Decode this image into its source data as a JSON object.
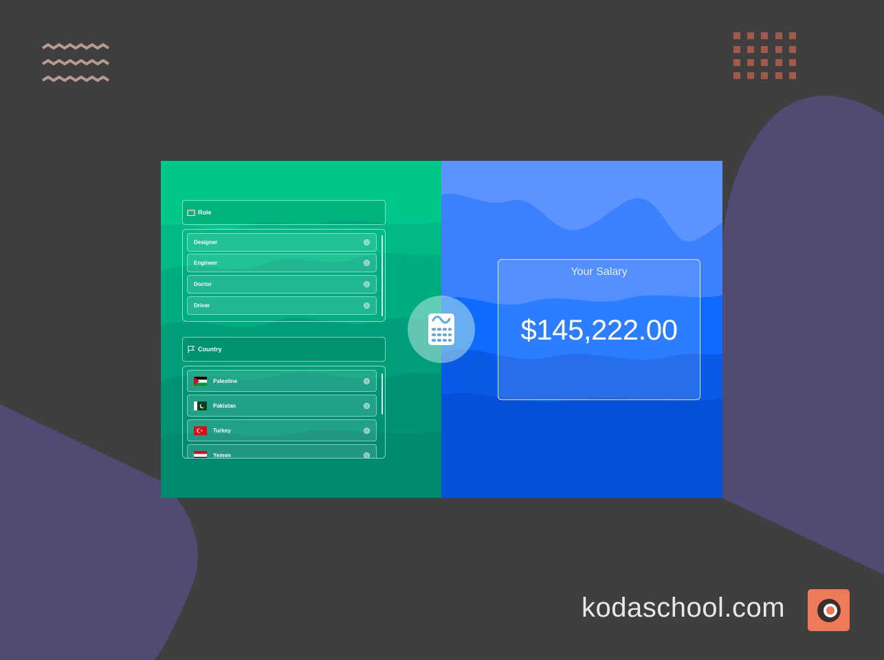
{
  "role": {
    "header": "Role",
    "options": [
      {
        "label": "Designer"
      },
      {
        "label": "Engineer"
      },
      {
        "label": "Doctor"
      },
      {
        "label": "Driver"
      }
    ]
  },
  "country": {
    "header": "Country",
    "options": [
      {
        "label": "Palestine",
        "flag": "palestine-flag-icon"
      },
      {
        "label": "Pakistan",
        "flag": "pakistan-flag-icon"
      },
      {
        "label": "Turkey",
        "flag": "turkey-flag-icon"
      },
      {
        "label": "Yemen",
        "flag": "yemen-flag-icon"
      }
    ]
  },
  "calculator": {
    "icon": "calculator-icon"
  },
  "salary": {
    "label": "Your Salary",
    "value": "$145,222.00"
  },
  "brand": {
    "text": "kodaschool.com",
    "accent": "#ef7a57"
  },
  "colors": {
    "left_pane": "#00c88a",
    "right_pane": "#5c94ff",
    "background": "#3f3f3f",
    "blob": "#514b73"
  }
}
